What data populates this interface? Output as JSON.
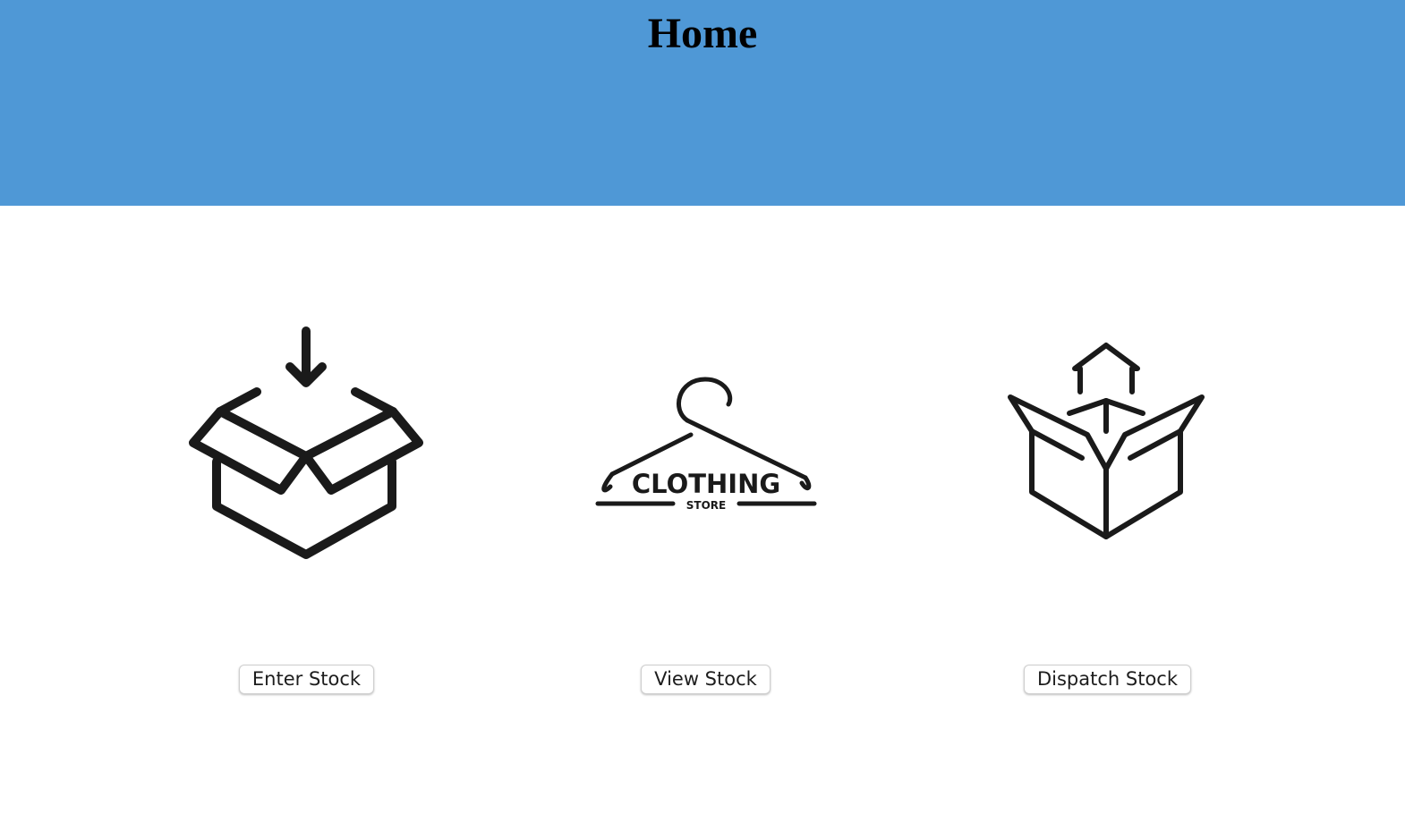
{
  "header": {
    "title": "Home",
    "background_color": "#4f98d6"
  },
  "tiles": [
    {
      "icon": "box-in-arrow-icon",
      "button_label": "Enter Stock"
    },
    {
      "icon": "clothing-store-logo",
      "logo_text": "CLOTHING",
      "logo_subtext": "STORE",
      "button_label": "View Stock"
    },
    {
      "icon": "box-out-arrow-icon",
      "button_label": "Dispatch Stock"
    }
  ]
}
